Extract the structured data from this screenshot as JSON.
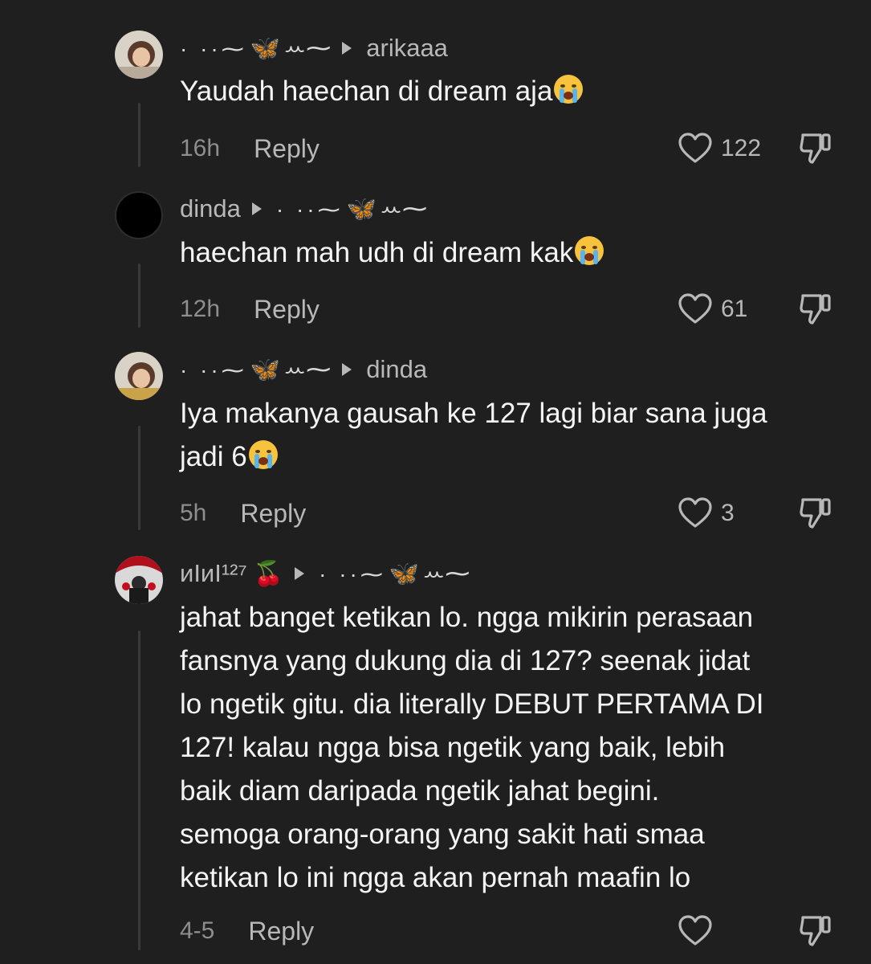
{
  "comments": [
    {
      "header": {
        "author_deco": "· ··⁓ 🦋ꕀ⁓",
        "reply_to": "arikaaa"
      },
      "text": "Yaudah haechan di dream aja",
      "time": "16h",
      "reply_label": "Reply",
      "likes": "122"
    },
    {
      "header": {
        "author": "dinda",
        "reply_to_deco": "· ··⁓ 🦋ꕀ⁓"
      },
      "text": "haechan mah udh di dream kak",
      "time": "12h",
      "reply_label": "Reply",
      "likes": "61"
    },
    {
      "header": {
        "author_deco": "· ··⁓ 🦋ꕀ⁓",
        "reply_to": "dinda"
      },
      "text_line1": "Iya makanya gausah ke 127 lagi biar sana juga",
      "text_line2": "jadi 6",
      "time": "5h",
      "reply_label": "Reply",
      "likes": "3"
    },
    {
      "header": {
        "author": "ᴎIᴎI¹²⁷",
        "author_emoji": "🍒",
        "reply_to_deco": "· ··⁓ 🦋ꕀ⁓"
      },
      "lines": [
        "jahat banget ketikan lo. ngga mikirin perasaan",
        "fansnya yang dukung dia di 127? seenak jidat",
        "lo ngetik gitu. dia literally DEBUT PERTAMA DI",
        "127! kalau ngga bisa ngetik yang baik, lebih",
        "baik diam daripada ngetik jahat begini.",
        "semoga orang-orang yang sakit hati smaa",
        "ketikan lo ini ngga akan pernah maafin lo"
      ],
      "time": "4-5",
      "reply_label": "Reply",
      "likes": ""
    }
  ],
  "icons": {
    "like": "heart-outline-icon",
    "dislike": "thumbs-down-icon",
    "emoji": "loudly-crying-face"
  },
  "colors": {
    "background": "#1f1f1f",
    "text": "#f4f4f4",
    "muted": "#8e8e8e",
    "butterfly": "#4aa8ff"
  }
}
